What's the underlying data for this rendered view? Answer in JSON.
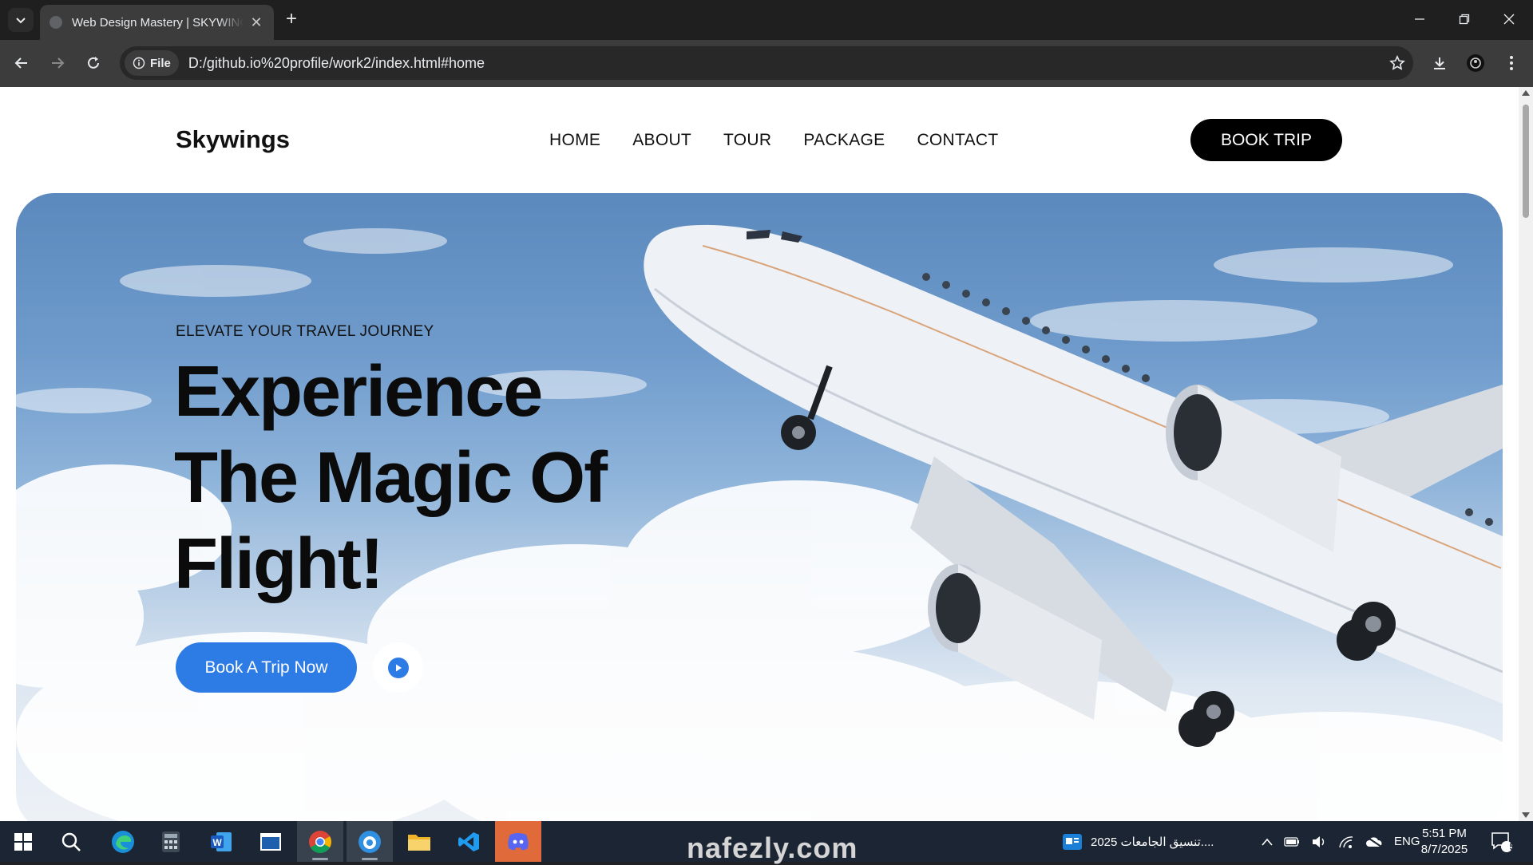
{
  "browser": {
    "tab_title": "Web Design Mastery | SKYWINGS",
    "url_chip": "File",
    "url": "D:/github.io%20profile/work2/index.html#home"
  },
  "site": {
    "logo": "Skywings",
    "nav": [
      "HOME",
      "ABOUT",
      "TOUR",
      "PACKAGE",
      "CONTACT"
    ],
    "book_trip": "BOOK TRIP",
    "hero": {
      "eyebrow": "ELEVATE YOUR TRAVEL JOURNEY",
      "headline_line1": "Experience",
      "headline_line2": "The Magic Of",
      "headline_line3": "Flight!",
      "cta": "Book A Trip Now"
    }
  },
  "watermark": "nafezly.com",
  "taskbar": {
    "notification_text": "تنسيق الجامعات 2025....",
    "language": "ENG",
    "time": "5:51 PM",
    "date": "8/7/2025",
    "notification_count": "5",
    "apps": [
      "start-icon",
      "search-icon",
      "edge-icon",
      "calculator-icon",
      "word-icon",
      "window-icon",
      "chrome-icon",
      "app-icon",
      "file-explorer-icon",
      "vscode-icon",
      "discord-icon"
    ]
  },
  "colors": {
    "accent": "#2d7be5",
    "nav_dark": "#000000",
    "taskbar": "#1c2533"
  }
}
